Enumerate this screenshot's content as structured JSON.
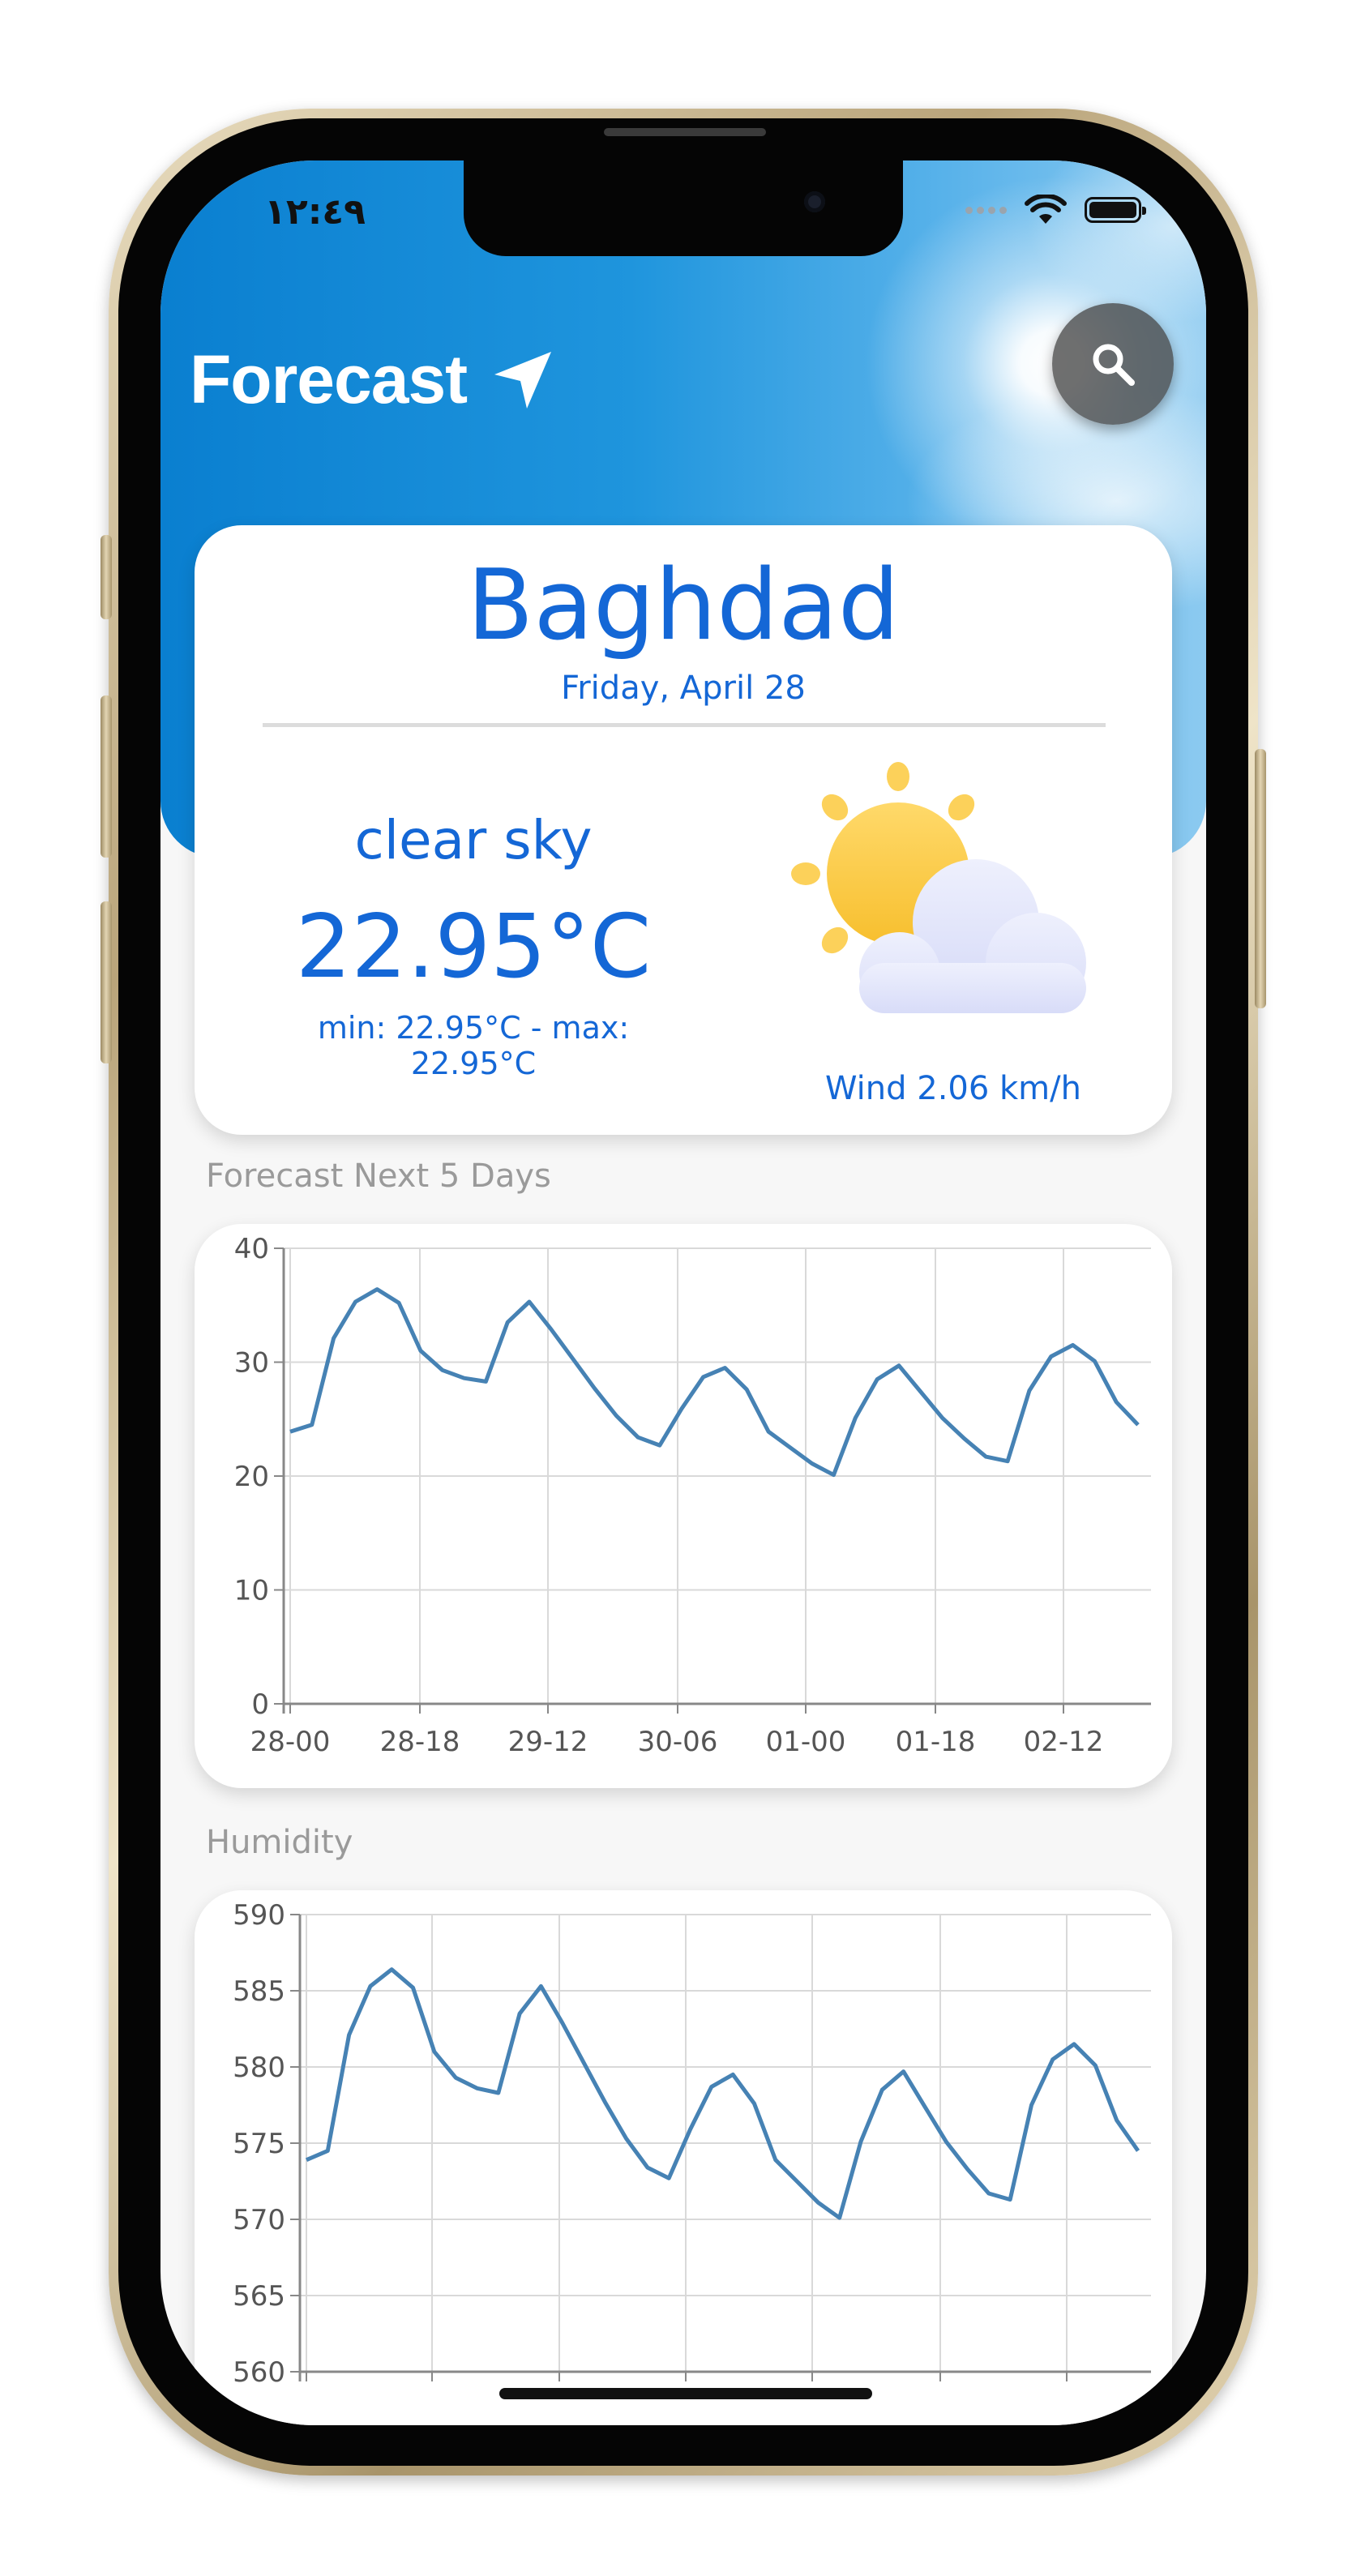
{
  "status_bar": {
    "time": "١٢:٤٩"
  },
  "header": {
    "title": "Forecast",
    "title_icon": "navigation-arrow-icon",
    "search_icon": "search-icon"
  },
  "current": {
    "city": "Baghdad",
    "date": "Friday, April 28",
    "description": "clear sky",
    "temperature": "22.95°C",
    "min_max": "min: 22.95°C - max: 22.95°C",
    "wind": "Wind 2.06 km/h",
    "weather_icon": "sun-behind-cloud-icon"
  },
  "colors": {
    "accent": "#1467d6",
    "line": "#4682b4",
    "label_gray": "#9a9a9a"
  },
  "sections": {
    "forecast_label": "Forecast Next 5 Days",
    "humidity_label": "Humidity"
  },
  "chart_data": [
    {
      "type": "line",
      "title": "",
      "xlabel": "",
      "ylabel": "",
      "x_tick_labels": [
        "28-00",
        "28-18",
        "29-12",
        "30-06",
        "01-00",
        "01-18",
        "02-12"
      ],
      "y_tick_labels": [
        "0",
        "10",
        "20",
        "30",
        "40"
      ],
      "ylim": [
        0,
        40
      ],
      "grid": true,
      "series": [
        {
          "values": [
            23.9,
            24.5,
            32.1,
            35.3,
            36.4,
            35.2,
            31.0,
            29.3,
            28.6,
            28.3,
            33.5,
            35.3,
            32.9,
            30.3,
            27.7,
            25.3,
            23.4,
            22.7,
            25.9,
            28.7,
            29.5,
            27.6,
            23.9,
            22.5,
            21.1,
            20.1,
            25.1,
            28.5,
            29.7,
            27.4,
            25.1,
            23.3,
            21.7,
            21.3,
            27.5,
            30.5,
            31.5,
            30.1,
            26.5,
            24.5
          ]
        }
      ]
    },
    {
      "type": "line",
      "title": "",
      "xlabel": "",
      "ylabel": "",
      "y_tick_labels": [
        "560",
        "565",
        "570",
        "575",
        "580",
        "585",
        "590"
      ],
      "ylim": [
        560,
        590
      ],
      "grid": true,
      "series": [
        {
          "values": [
            573.9,
            574.5,
            582.1,
            585.3,
            586.4,
            585.2,
            581.0,
            579.3,
            578.6,
            578.3,
            583.5,
            585.3,
            582.9,
            580.3,
            577.7,
            575.3,
            573.4,
            572.7,
            575.9,
            578.7,
            579.5,
            577.6,
            573.9,
            572.5,
            571.1,
            570.1,
            575.1,
            578.5,
            579.7,
            577.4,
            575.1,
            573.3,
            571.7,
            571.3,
            577.5,
            580.5,
            581.5,
            580.1,
            576.5,
            574.5
          ]
        }
      ]
    }
  ]
}
